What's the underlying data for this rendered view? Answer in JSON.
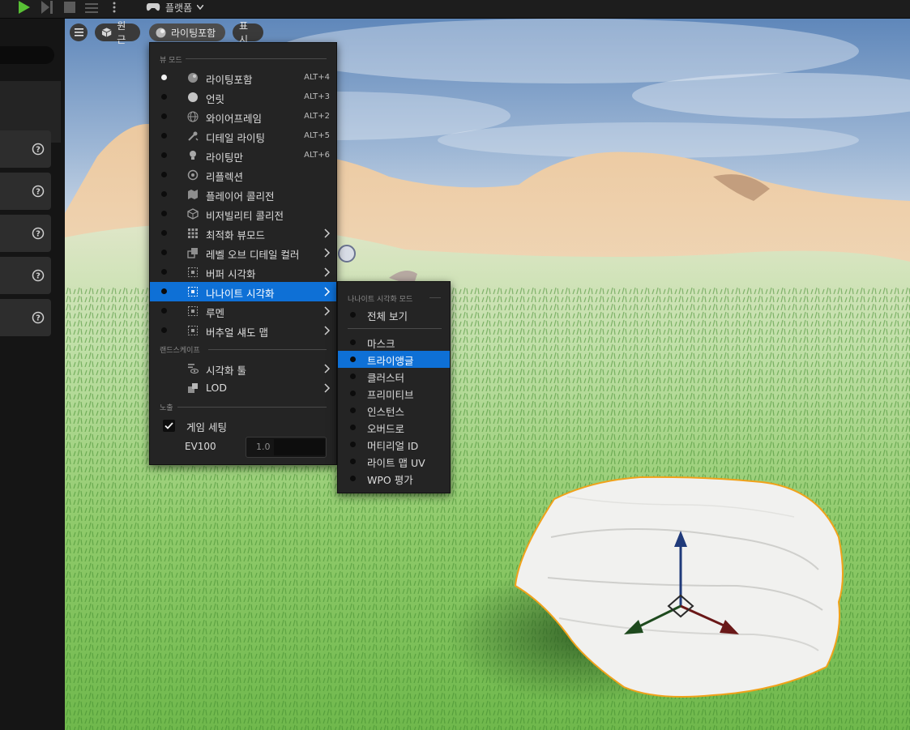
{
  "toolbar": {
    "platforms_label": "플랫폼"
  },
  "viewport": {
    "perspective_label": "원근",
    "viewmode_label": "라이팅포함",
    "show_label": "표시"
  },
  "view_mode_menu": {
    "section_view_mode": "뷰 모드",
    "items": [
      {
        "label": "라이팅포함",
        "shortcut": "ALT+4",
        "icon": "lit-sphere-icon",
        "selected_radio": true
      },
      {
        "label": "언릿",
        "shortcut": "ALT+3",
        "icon": "unlit-sphere-icon"
      },
      {
        "label": "와이어프레임",
        "shortcut": "ALT+2",
        "icon": "wireframe-sphere-icon"
      },
      {
        "label": "디테일 라이팅",
        "shortcut": "ALT+5",
        "icon": "detail-lighting-icon"
      },
      {
        "label": "라이팅만",
        "shortcut": "ALT+6",
        "icon": "lightbulb-icon"
      },
      {
        "label": "리플렉션",
        "shortcut": "",
        "icon": "reflection-icon"
      },
      {
        "label": "플레이어 콜리전",
        "shortcut": "",
        "icon": "player-collision-icon"
      },
      {
        "label": "비저빌리티 콜리전",
        "shortcut": "",
        "icon": "visibility-collision-icon"
      },
      {
        "label": "최적화 뷰모드",
        "shortcut": "",
        "icon": "optimization-grid-icon",
        "submenu": true
      },
      {
        "label": "레벨 오브 디테일 컬러",
        "shortcut": "",
        "icon": "lod-coloration-icon",
        "submenu": true
      },
      {
        "label": "버퍼 시각화",
        "shortcut": "",
        "icon": "buffer-visualization-icon",
        "submenu": true
      },
      {
        "label": "나나이트 시각화",
        "shortcut": "",
        "icon": "nanite-visualization-icon",
        "submenu": true,
        "highlighted": true
      },
      {
        "label": "루멘",
        "shortcut": "",
        "icon": "lumen-icon",
        "submenu": true
      },
      {
        "label": "버추얼 섀도 맵",
        "shortcut": "",
        "icon": "virtual-shadow-map-icon",
        "submenu": true
      }
    ],
    "section_landscape": "랜드스케이프",
    "landscape_items": [
      {
        "label": "시각화 툴",
        "icon": "visualizer-tool-icon",
        "submenu": true
      },
      {
        "label": "LOD",
        "icon": "lod-icon",
        "submenu": true
      }
    ],
    "section_exposure": "노출",
    "game_settings_label": "게임 세팅",
    "game_settings_checked": true,
    "ev100_label": "EV100",
    "ev100_value": "1.0"
  },
  "nanite_menu": {
    "section_title": "나나이트 시각화 모드",
    "overview_label": "전체 보기",
    "items": [
      {
        "label": "마스크"
      },
      {
        "label": "트라이앵글",
        "highlighted": true
      },
      {
        "label": "클러스터"
      },
      {
        "label": "프리미티브"
      },
      {
        "label": "인스턴스"
      },
      {
        "label": "오버드로"
      },
      {
        "label": "머티리얼 ID"
      },
      {
        "label": "라이트 맵 UV"
      },
      {
        "label": "WPO 평가"
      }
    ]
  },
  "colors": {
    "accent": "#0e70d6",
    "play": "#58c035",
    "selection_outline": "#f0a21a"
  }
}
